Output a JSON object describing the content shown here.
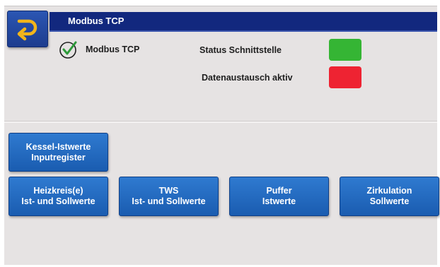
{
  "header": {
    "title": "Modbus TCP"
  },
  "status": {
    "module_label": "Modbus TCP",
    "rows": [
      {
        "label": "Status Schnittstelle",
        "color": "#35b534"
      },
      {
        "label": "Datenaustausch aktiv",
        "color": "#ee2332"
      }
    ]
  },
  "icons": {
    "back": "return-arrow-icon",
    "check": "checkmark-circle-icon"
  },
  "buttons": [
    {
      "line1": "Kessel-Istwerte",
      "line2": "Inputregister"
    },
    {
      "line1": "Heizkreis(e)",
      "line2": "Ist- und Sollwerte"
    },
    {
      "line1": "TWS",
      "line2": "Ist- und Sollwerte"
    },
    {
      "line1": "Puffer",
      "line2": "Istwerte"
    },
    {
      "line1": "Zirkulation",
      "line2": "Sollwerte"
    }
  ]
}
